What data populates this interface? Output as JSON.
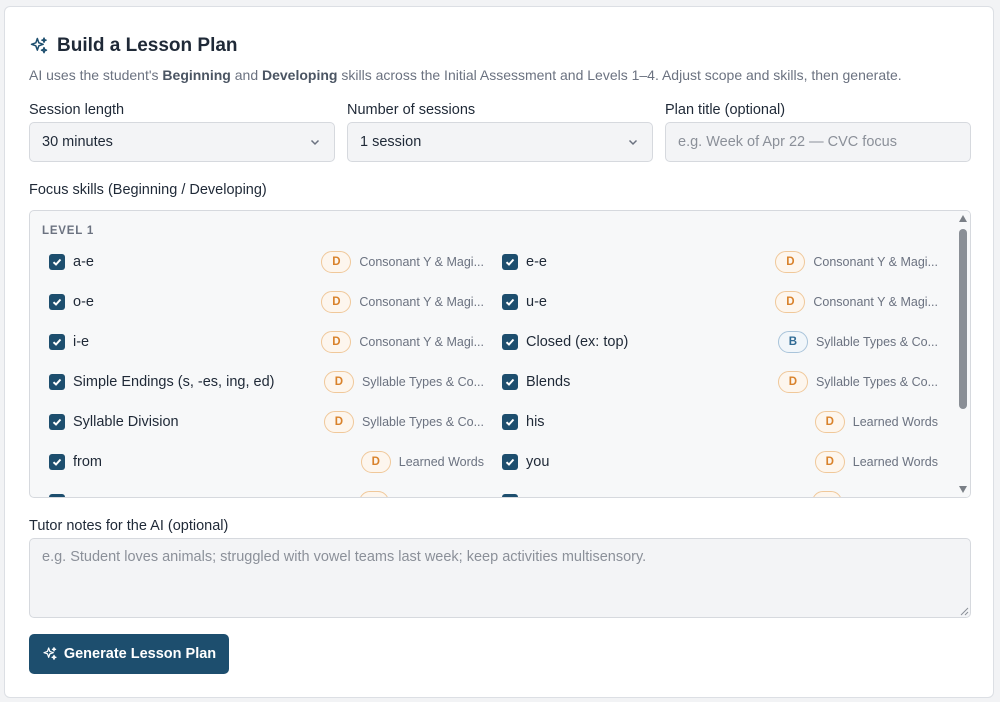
{
  "header": {
    "title": "Build a Lesson Plan",
    "icon": "sparkles-icon",
    "subtitle_parts": [
      "AI uses the student's ",
      "Beginning",
      " and ",
      "Developing",
      " skills across the Initial Assessment and Levels 1–4. Adjust scope and skills, then generate."
    ]
  },
  "session_length": {
    "label": "Session length",
    "value": "30 minutes"
  },
  "num_sessions": {
    "label": "Number of sessions",
    "value": "1 session"
  },
  "plan_title": {
    "label": "Plan title (optional)",
    "placeholder": "e.g. Week of Apr 22 — CVC focus",
    "value": ""
  },
  "focus": {
    "label": "Focus skills (Beginning / Developing)",
    "level_label": "LEVEL 1",
    "left": [
      {
        "name": "a-e",
        "badge": "D",
        "category": "Consonant Y & Magi...",
        "checked": true
      },
      {
        "name": "o-e",
        "badge": "D",
        "category": "Consonant Y & Magi...",
        "checked": true
      },
      {
        "name": "i-e",
        "badge": "D",
        "category": "Consonant Y & Magi...",
        "checked": true
      },
      {
        "name": "Simple Endings (s, -es, ing, ed)",
        "badge": "D",
        "category": "Syllable Types & Co...",
        "checked": true
      },
      {
        "name": "Syllable Division",
        "badge": "D",
        "category": "Syllable Types & Co...",
        "checked": true
      },
      {
        "name": "from",
        "badge": "D",
        "category": "Learned Words",
        "checked": true
      }
    ],
    "right": [
      {
        "name": "e-e",
        "badge": "D",
        "category": "Consonant Y & Magi...",
        "checked": true
      },
      {
        "name": "u-e",
        "badge": "D",
        "category": "Consonant Y & Magi...",
        "checked": true
      },
      {
        "name": "Closed (ex: top)",
        "badge": "B",
        "category": "Syllable Types & Co...",
        "checked": true
      },
      {
        "name": "Blends",
        "badge": "D",
        "category": "Syllable Types & Co...",
        "checked": true
      },
      {
        "name": "his",
        "badge": "D",
        "category": "Learned Words",
        "checked": true
      },
      {
        "name": "you",
        "badge": "D",
        "category": "Learned Words",
        "checked": true
      }
    ]
  },
  "notes": {
    "label": "Tutor notes for the AI (optional)",
    "placeholder": "e.g. Student loves animals; struggled with vowel teams last week; keep activities multisensory.",
    "value": ""
  },
  "generate_button": {
    "label": "Generate Lesson Plan",
    "icon": "sparkles-icon"
  },
  "colors": {
    "primary": "#1d4e6e",
    "developing_badge": "#d9822b",
    "beginning_badge": "#2f6a94"
  }
}
